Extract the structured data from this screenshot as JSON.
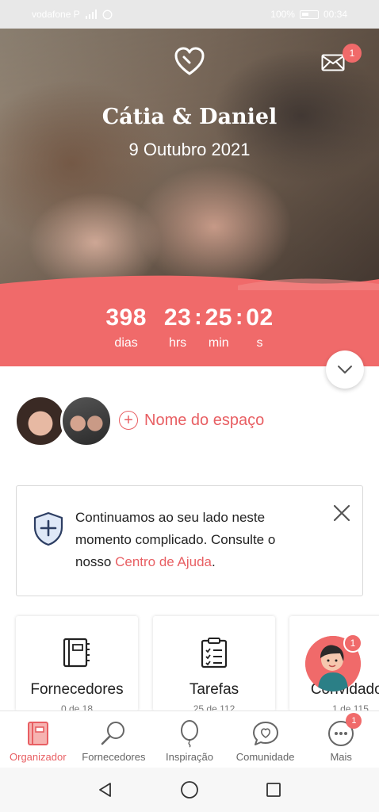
{
  "status_bar": {
    "carrier": "vodafone P",
    "battery_percent": "100%",
    "time": "00:34"
  },
  "hero": {
    "couple_name": "Cátia & Daniel",
    "wedding_date": "9 Outubro 2021",
    "mail_badge_count": "1",
    "heart_icon": "heart-icon",
    "mail_icon": "mail-icon"
  },
  "countdown": {
    "days": "398",
    "days_label": "dias",
    "hours": "23",
    "hours_label": "hrs",
    "minutes": "25",
    "minutes_label": "min",
    "seconds": "02",
    "seconds_label": "s"
  },
  "space": {
    "label": "Nome do espaço"
  },
  "info_card": {
    "text_before": "Continuamos ao seu lado neste momento complicado. Consulte o nosso ",
    "link_text": "Centro de Ajuda",
    "text_after": "."
  },
  "tools": [
    {
      "title": "Fornecedores",
      "subtitle": "0 de 18"
    },
    {
      "title": "Tarefas",
      "subtitle": "25 de 112"
    },
    {
      "title": "Convidados",
      "subtitle": "1 de 115"
    }
  ],
  "chat_badge": "1",
  "bottom_nav": [
    {
      "label": "Organizador",
      "icon": "notebook-icon",
      "active": true
    },
    {
      "label": "Fornecedores",
      "icon": "search-icon",
      "active": false
    },
    {
      "label": "Inspiração",
      "icon": "balloon-icon",
      "active": false
    },
    {
      "label": "Comunidade",
      "icon": "chat-heart-icon",
      "active": false
    },
    {
      "label": "Mais",
      "icon": "more-icon",
      "active": false,
      "badge": "1"
    }
  ],
  "colors": {
    "accent": "#f06a6a",
    "accent_text": "#e85f63"
  }
}
